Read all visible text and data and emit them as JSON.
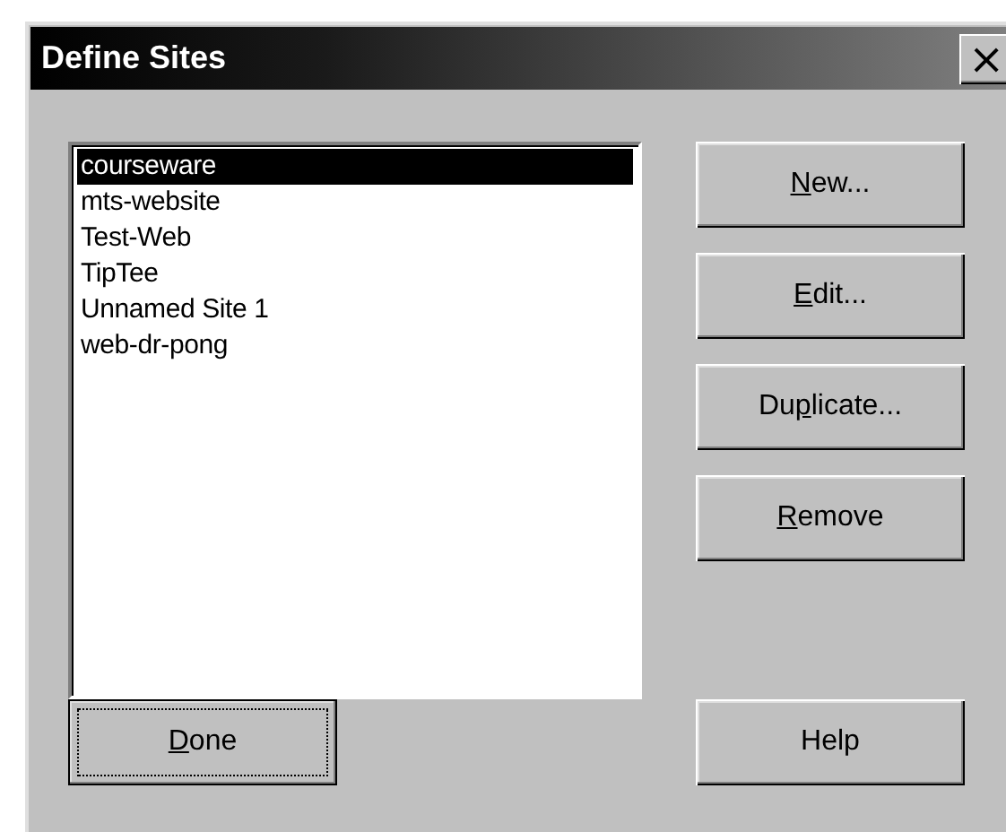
{
  "window": {
    "title": "Define Sites",
    "close": "×"
  },
  "sites": [
    {
      "label": "courseware",
      "selected": true
    },
    {
      "label": "mts-website",
      "selected": false
    },
    {
      "label": "Test-Web",
      "selected": false
    },
    {
      "label": "TipTee",
      "selected": false
    },
    {
      "label": "Unnamed Site 1",
      "selected": false
    },
    {
      "label": "web-dr-pong",
      "selected": false
    }
  ],
  "side_buttons": [
    {
      "key": "N",
      "post": "ew..."
    },
    {
      "key": "E",
      "post": "dit..."
    },
    {
      "pre": "Du",
      "key": "p",
      "post": "licate..."
    },
    {
      "key": "R",
      "post": "emove"
    }
  ],
  "bottom_buttons": [
    {
      "key": "D",
      "post": "one",
      "focused": true
    },
    {
      "pre": "Help",
      "focused": false
    }
  ]
}
